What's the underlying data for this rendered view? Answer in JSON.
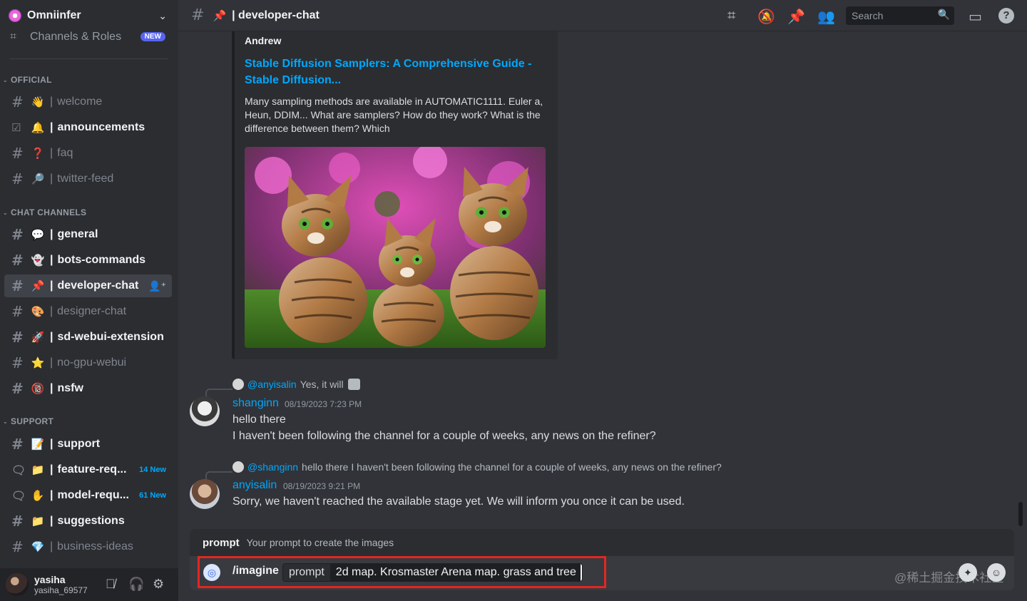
{
  "server": {
    "name": "Omniinfer"
  },
  "sidebar": {
    "roles_label": "Channels & Roles",
    "roles_badge": "NEW",
    "categories": [
      {
        "label": "OFFICIAL"
      },
      {
        "label": "CHAT CHANNELS"
      },
      {
        "label": "SUPPORT"
      }
    ],
    "channels": [
      {
        "emoji": "👋",
        "name": "welcome"
      },
      {
        "emoji": "🔔",
        "name": "announcements"
      },
      {
        "emoji": "❓",
        "name": "faq"
      },
      {
        "emoji": "🔎",
        "name": "twitter-feed"
      },
      {
        "emoji": "💬",
        "name": "general"
      },
      {
        "emoji": "👻",
        "name": "bots-commands"
      },
      {
        "emoji": "📌",
        "name": "developer-chat"
      },
      {
        "emoji": "🎨",
        "name": "designer-chat"
      },
      {
        "emoji": "🚀",
        "name": "sd-webui-extension"
      },
      {
        "emoji": "⭐",
        "name": "no-gpu-webui"
      },
      {
        "emoji": "🔞",
        "name": "nsfw"
      },
      {
        "emoji": "📝",
        "name": "support"
      },
      {
        "emoji": "📁",
        "name": "feature-req...",
        "badge": "14 New"
      },
      {
        "emoji": "✋",
        "name": "model-requ...",
        "badge": "61 New"
      },
      {
        "emoji": "📁",
        "name": "suggestions"
      },
      {
        "emoji": "💎",
        "name": "business-ideas"
      }
    ]
  },
  "user": {
    "name": "yasiha",
    "tag": "yasiha_69577"
  },
  "header": {
    "channel_emoji": "📌",
    "channel_name": "| developer-chat",
    "search_placeholder": "Search"
  },
  "embed": {
    "author": "Andrew",
    "title": "Stable Diffusion Samplers: A Comprehensive Guide - Stable Diffusion...",
    "description": "Many sampling methods are available in AUTOMATIC1111. Euler a, Heun, DDIM... What are samplers? How do they work? What is the difference between them? Which"
  },
  "messages": [
    {
      "reply_to": "@anyisalin",
      "reply_text": "Yes, it will",
      "author": "shanginn",
      "timestamp": "08/19/2023 7:23 PM",
      "lines": [
        "hello there",
        "I haven't been following the channel for a couple of weeks, any news on the refiner?"
      ]
    },
    {
      "reply_to": "@shanginn",
      "reply_text": "hello there I haven't been following the channel for a couple of weeks, any news on the refiner?",
      "author": "anyisalin",
      "timestamp": "08/19/2023 9:21 PM",
      "lines": [
        "Sorry, we haven't reached the available stage yet. We will inform you once it can be used."
      ]
    }
  ],
  "composer": {
    "option_name": "prompt",
    "option_desc": "Your prompt to create the images",
    "command": "/imagine",
    "param_label": "prompt",
    "param_value": "2d map. Krosmaster Arena map. grass and tree"
  },
  "watermark": "@稀土掘金技术社区",
  "colors": {
    "accent_link": "#00a8fc",
    "highlight_border": "#e5261f",
    "badge": "#5865f2"
  }
}
